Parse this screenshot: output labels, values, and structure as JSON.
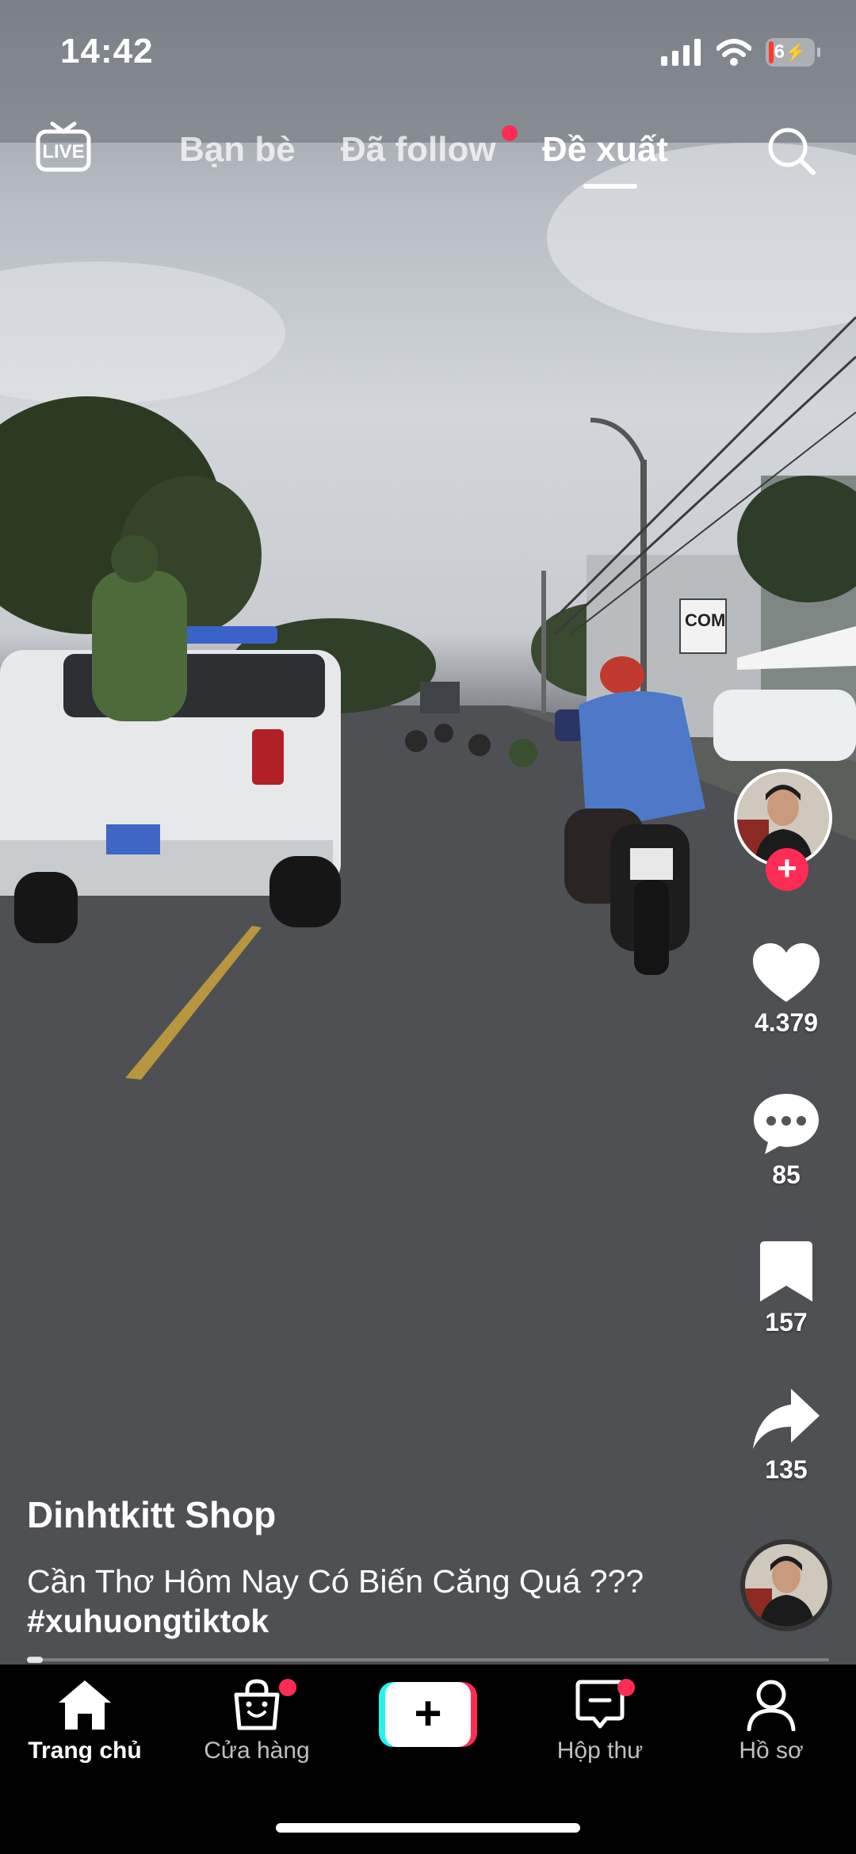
{
  "status_bar": {
    "time": "14:42",
    "battery_level": "6",
    "icons": [
      "cellular-signal-icon",
      "wifi-icon",
      "battery-low-charging-icon"
    ]
  },
  "top_nav": {
    "live_label": "LIVE",
    "tabs": [
      {
        "label": "Bạn bè",
        "active": false
      },
      {
        "label": "Đã follow",
        "active": false,
        "has_dot": true
      },
      {
        "label": "Đề xuất",
        "active": true
      }
    ],
    "search_icon": "search-icon"
  },
  "video": {
    "author": "Dinhtkitt Shop",
    "caption_text": "Cần Thơ Hôm Nay Có Biến Căng Quá ???",
    "hashtag": "#xuhuongtiktok",
    "progress": 0.02,
    "scene_sign_text": "COM"
  },
  "actions": {
    "follow_icon": "plus-icon",
    "likes": "4.379",
    "comments": "85",
    "saves": "157",
    "shares": "135"
  },
  "bottom_nav": {
    "items": [
      {
        "label": "Trang chủ",
        "icon": "home-icon",
        "active": true,
        "badge": false
      },
      {
        "label": "Cửa hàng",
        "icon": "shopping-bag-icon",
        "active": false,
        "badge": true
      },
      {
        "label": "",
        "icon": "create-plus-icon",
        "active": false,
        "badge": false
      },
      {
        "label": "Hộp thư",
        "icon": "inbox-icon",
        "active": false,
        "badge": true
      },
      {
        "label": "Hồ sơ",
        "icon": "profile-icon",
        "active": false,
        "badge": false
      }
    ],
    "create_symbol": "+"
  },
  "colors": {
    "accent": "#fe2c55",
    "cyan": "#25f4ee",
    "bar_background": "#000000"
  }
}
